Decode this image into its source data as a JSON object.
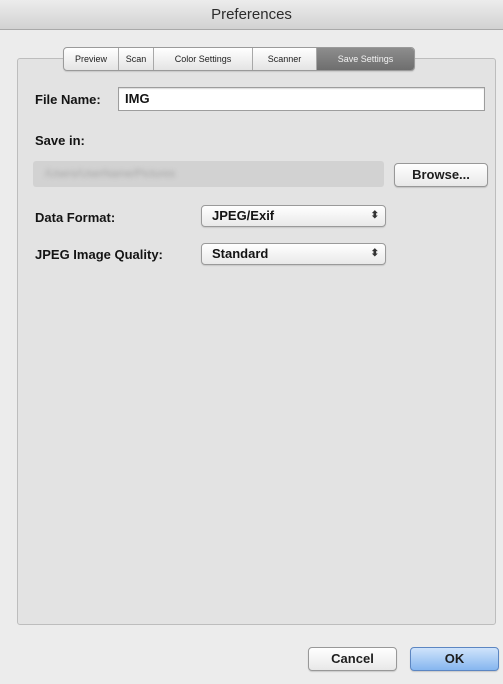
{
  "window": {
    "title": "Preferences"
  },
  "tabs": [
    {
      "label": "Preview",
      "active": false
    },
    {
      "label": "Scan",
      "active": false
    },
    {
      "label": "Color Settings",
      "active": false
    },
    {
      "label": "Scanner",
      "active": false
    },
    {
      "label": "Save Settings",
      "active": true
    }
  ],
  "file_name": {
    "label": "File Name:",
    "value": "IMG"
  },
  "save_in": {
    "label": "Save in:",
    "path": "/Users/UserName/Pictures",
    "browse_label": "Browse..."
  },
  "data_format": {
    "label": "Data Format:",
    "value": "JPEG/Exif"
  },
  "jpeg_quality": {
    "label": "JPEG Image Quality:",
    "value": "Standard"
  },
  "footer": {
    "cancel_label": "Cancel",
    "ok_label": "OK"
  },
  "colors": {
    "accent": "#86b6ef",
    "active_tab": "#7a7a7a"
  },
  "icons": {
    "select_arrows": "up-down-chevron-icon"
  }
}
